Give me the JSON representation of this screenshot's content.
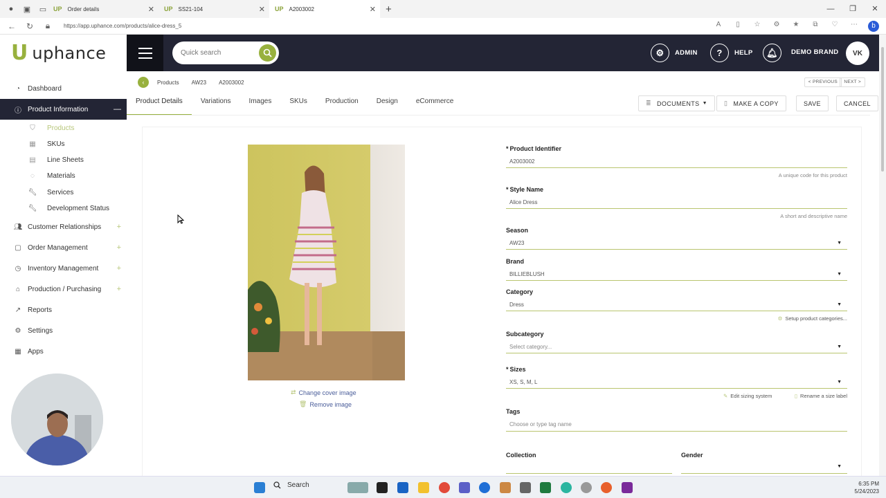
{
  "browser": {
    "tabs": [
      {
        "title": "Order details",
        "favicon": "UP"
      },
      {
        "title": "SS21-104",
        "favicon": "UP"
      },
      {
        "title": "A2003002",
        "favicon": "UP"
      }
    ],
    "url": "https://app.uphance.com/products/alice-dress_5"
  },
  "app": {
    "logo_mark": "U",
    "logo_text": "uphance",
    "search_placeholder": "Quick search",
    "header": {
      "admin": "ADMIN",
      "help": "HELP",
      "brand": "DEMO BRAND",
      "avatar": "VK"
    }
  },
  "sidebar": {
    "items": [
      {
        "label": "Dashboard",
        "icon": "dashboard-icon"
      },
      {
        "label": "Product Information",
        "icon": "info-icon",
        "expanded": true
      },
      {
        "label": "Customer Relationships",
        "icon": "users-icon"
      },
      {
        "label": "Order Management",
        "icon": "clipboard-icon"
      },
      {
        "label": "Inventory Management",
        "icon": "inventory-icon"
      },
      {
        "label": "Production / Purchasing",
        "icon": "factory-icon"
      },
      {
        "label": "Reports",
        "icon": "chart-icon"
      },
      {
        "label": "Settings",
        "icon": "gear-icon"
      },
      {
        "label": "Apps",
        "icon": "grid-icon"
      }
    ],
    "sub_items": [
      {
        "label": "Products"
      },
      {
        "label": "SKUs"
      },
      {
        "label": "Line Sheets"
      },
      {
        "label": "Materials"
      },
      {
        "label": "Services"
      },
      {
        "label": "Development Status"
      }
    ]
  },
  "breadcrumb": [
    "Products",
    "AW23",
    "A2003002"
  ],
  "pager": {
    "previous": "< PREVIOUS",
    "next": "NEXT >"
  },
  "tabs": [
    "Product Details",
    "Variations",
    "Images",
    "SKUs",
    "Production",
    "Design",
    "eCommerce"
  ],
  "actions": {
    "documents": "DOCUMENTS",
    "make_copy": "MAKE A COPY",
    "save": "SAVE",
    "cancel": "CANCEL"
  },
  "image_links": {
    "change": "Change cover image",
    "remove": "Remove image"
  },
  "form": {
    "product_identifier": {
      "label": "Product Identifier",
      "value": "A2003002",
      "help": "A unique code for this product"
    },
    "style_name": {
      "label": "Style Name",
      "value": "Alice Dress",
      "help": "A short and descriptive name"
    },
    "season": {
      "label": "Season",
      "value": "AW23"
    },
    "brand": {
      "label": "Brand",
      "value": "BILLIEBLUSH"
    },
    "category": {
      "label": "Category",
      "value": "Dress",
      "link": "Setup product categories..."
    },
    "subcategory": {
      "label": "Subcategory",
      "placeholder": "Select category..."
    },
    "sizes": {
      "label": "Sizes",
      "value": "XS, S, M, L",
      "link_edit": "Edit sizing system",
      "link_rename": "Rename a size label"
    },
    "tags": {
      "label": "Tags",
      "placeholder": "Choose or type tag name"
    },
    "collection": {
      "label": "Collection"
    },
    "gender": {
      "label": "Gender"
    }
  },
  "taskbar": {
    "search": "Search",
    "time": "6:35 PM",
    "date": "5/24/2023"
  }
}
